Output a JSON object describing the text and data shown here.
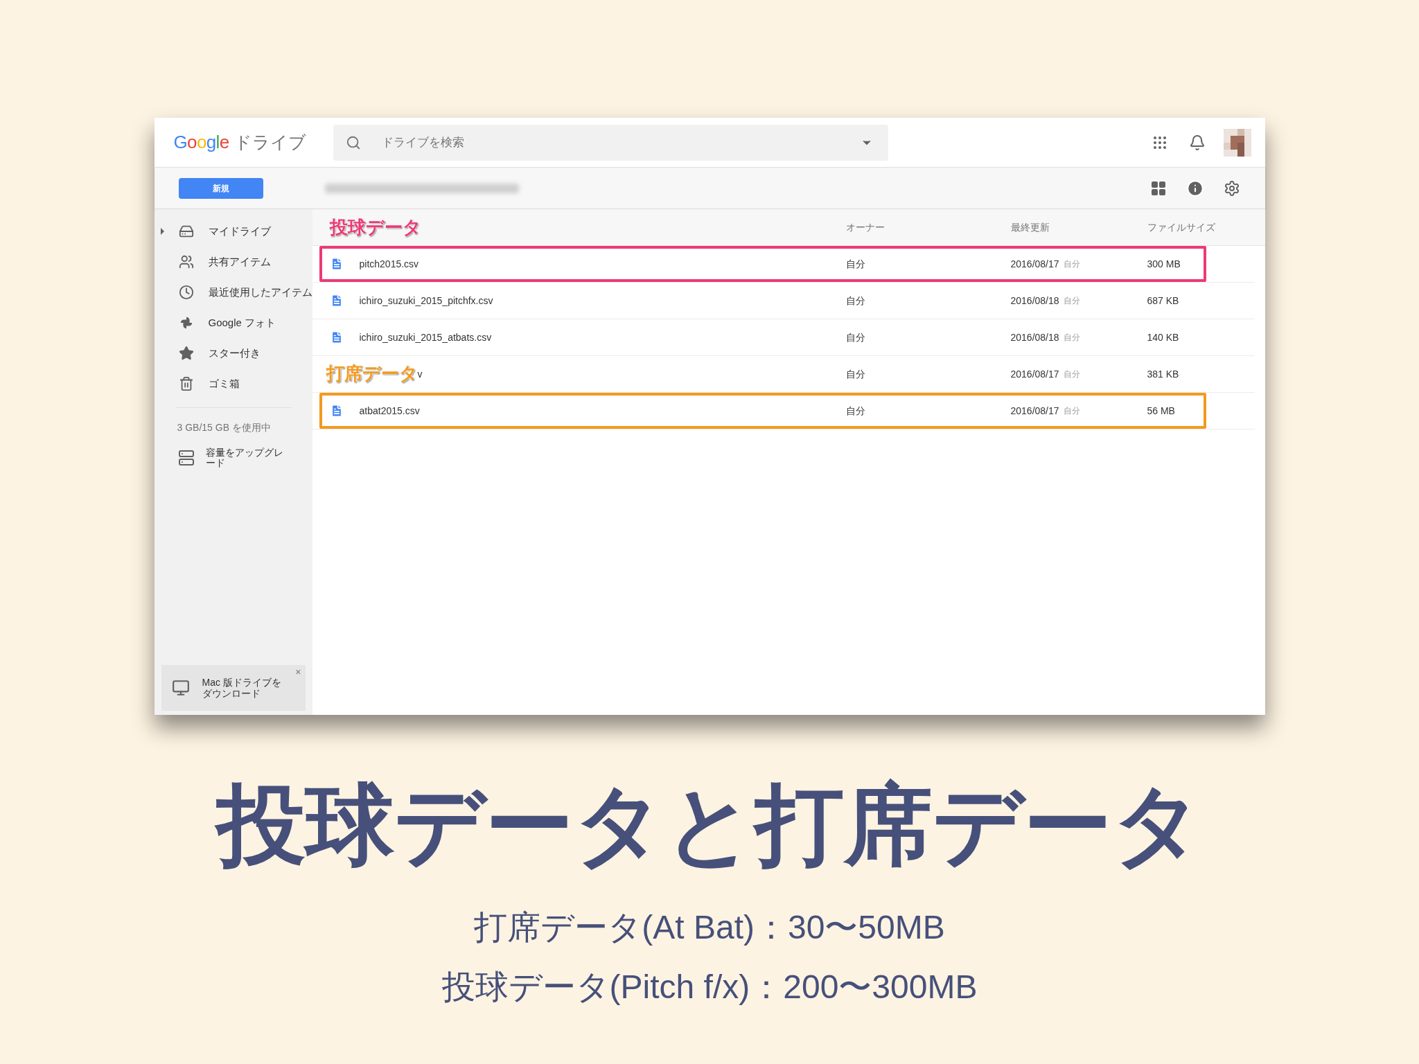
{
  "window": {
    "logo": "Google",
    "product": "ドライブ"
  },
  "search": {
    "placeholder": "ドライブを検索"
  },
  "new_button": "新規",
  "sidebar": {
    "items": [
      {
        "label": "マイドライブ",
        "kind": "drive",
        "expandable": true
      },
      {
        "label": "共有アイテム",
        "kind": "shared",
        "expandable": false
      },
      {
        "label": "最近使用したアイテム",
        "kind": "recent",
        "expandable": false
      },
      {
        "label": "Google フォト",
        "kind": "photos",
        "expandable": false
      },
      {
        "label": "スター付き",
        "kind": "starred",
        "expandable": false
      },
      {
        "label": "ゴミ箱",
        "kind": "trash",
        "expandable": false
      }
    ],
    "storage": "3 GB/15 GB を使用中",
    "upgrade": "容量をアップグレード",
    "promo": "Mac 版ドライブをダウンロード",
    "promo_close": "×"
  },
  "table": {
    "columns": [
      "オーナー",
      "最終更新",
      "ファイルサイズ"
    ],
    "rows": [
      {
        "name": "pitch2015.csv",
        "owner": "自分",
        "modified": "2016/08/17",
        "modified_by": "自分",
        "size": "300 MB",
        "color": "#ec3a74"
      },
      {
        "name": "ichiro_suzuki_2015_pitchfx.csv",
        "owner": "自分",
        "modified": "2016/08/18",
        "modified_by": "自分",
        "size": "687 KB"
      },
      {
        "name": "ichiro_suzuki_2015_atbats.csv",
        "owner": "自分",
        "modified": "2016/08/18",
        "modified_by": "自分",
        "size": "140 KB"
      },
      {
        "name": "v",
        "owner": "自分",
        "modified": "2016/08/17",
        "modified_by": "自分",
        "size": "381 KB",
        "overlay_label": {
          "text": "打席データ",
          "color": "#f39a1e"
        }
      },
      {
        "name": "atbat2015.csv",
        "owner": "自分",
        "modified": "2016/08/17",
        "modified_by": "自分",
        "size": "56 MB",
        "color": "#f39a1e"
      }
    ]
  },
  "annotation": {
    "text": "投球データ",
    "color": "#ec3a74"
  },
  "slide": {
    "title": "投球データと打席データ",
    "lines": [
      "打席データ(At Bat)：30〜50MB",
      "投球データ(Pitch f/x)：200〜300MB"
    ]
  }
}
